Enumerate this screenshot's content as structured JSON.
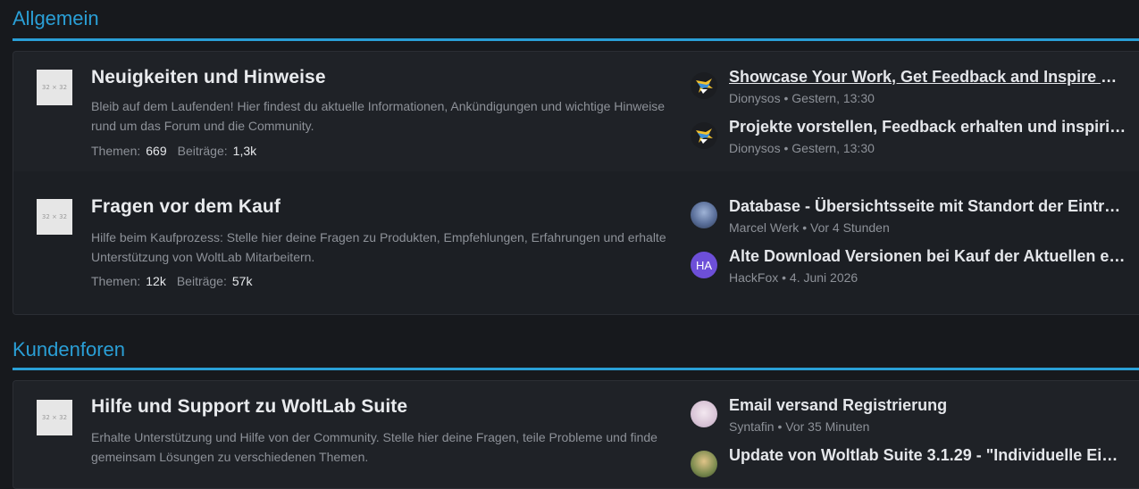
{
  "sections": [
    {
      "title": "Allgemein",
      "boards": [
        {
          "icon_text": "32 × 32",
          "title": "Neuigkeiten und Hinweise",
          "description": "Bleib auf dem Laufenden! Hier findest du aktuelle Informationen, Ankündigungen und wichtige Hinweise rund um das Forum und die Community.",
          "stats": {
            "themes_label": "Themen:",
            "themes_value": "669",
            "posts_label": "Beiträge:",
            "posts_value": "1,3k"
          },
          "last_posts": [
            {
              "title": "Showcase Your Work, Get Feedback and Inspire Ot…",
              "author": "Dionysos",
              "time": "Gestern, 13:30",
              "avatar": "bird-logo"
            },
            {
              "title": "Projekte vorstellen, Feedback erhalten und inspirie…",
              "author": "Dionysos",
              "time": "Gestern, 13:30",
              "avatar": "bird-logo"
            }
          ]
        },
        {
          "icon_text": "32 × 32",
          "title": "Fragen vor dem Kauf",
          "description": "Hilfe beim Kaufprozess: Stelle hier deine Fragen zu Produkten, Empfehlungen, Erfahrungen und erhalte Unterstützung von WoltLab Mitarbeitern.",
          "stats": {
            "themes_label": "Themen:",
            "themes_value": "12k",
            "posts_label": "Beiträge:",
            "posts_value": "57k"
          },
          "last_posts": [
            {
              "title": "Database - Übersichtsseite mit Standort der Einträ…",
              "author": "Marcel Werk",
              "time": "Vor 4 Stunden",
              "avatar": "photo"
            },
            {
              "title": "Alte Download Versionen bei Kauf der Aktuellen e…",
              "author": "HackFox",
              "time": "4. Juni 2026",
              "avatar": "initials",
              "initials": "HA"
            }
          ]
        }
      ]
    },
    {
      "title": "Kundenforen",
      "boards": [
        {
          "icon_text": "32 × 32",
          "title": "Hilfe und Support zu WoltLab Suite",
          "description": "Erhalte Unterstützung und Hilfe von der Community. Stelle hier deine Fragen, teile Probleme und finde gemeinsam Lösungen zu verschiedenen Themen.",
          "last_posts": [
            {
              "title": "Email versand Registrierung",
              "author": "Syntafin",
              "time": "Vor 35 Minuten",
              "avatar": "anime"
            },
            {
              "title": "Update von Woltlab Suite 3.1.29 - \"Individuelle Ein…",
              "author": "",
              "time": "",
              "avatar": "photo2"
            }
          ]
        }
      ]
    }
  ],
  "meta_separator": "•",
  "colors": {
    "accent": "#2a9fd6",
    "background": "#17191d",
    "box": "#1f2227",
    "initials_avatar": "#6d4fd8"
  }
}
